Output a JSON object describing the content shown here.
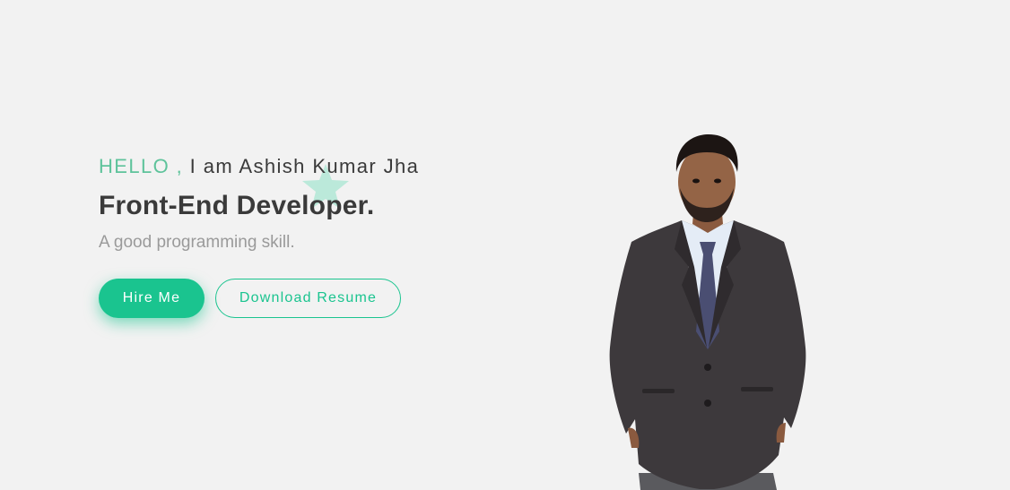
{
  "hero": {
    "greeting_hello": "HELLO ,",
    "greeting_rest": " I am Ashish Kumar Jha",
    "role": "Front-End Developer.",
    "tagline": "A good programming skill.",
    "hire_button": "Hire Me",
    "resume_button": "Download Resume"
  },
  "colors": {
    "accent": "#1ac48f",
    "hello": "#5ec39b",
    "heading": "#3a3a3a",
    "muted": "#9a9a9a",
    "background": "#f2f2f2"
  },
  "icons": {
    "decor": "star-icon"
  }
}
